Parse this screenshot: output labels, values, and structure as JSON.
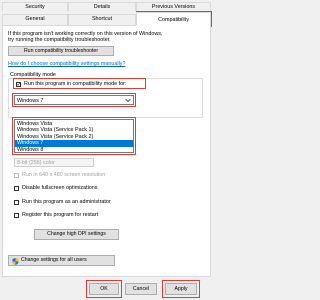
{
  "tabs_row1": [
    "Security",
    "Details",
    "Previous Versions"
  ],
  "tabs_row2": [
    "General",
    "Shortcut",
    "Compatibility"
  ],
  "intro_text_line1": "If this program isn't working correctly on this version of Windows,",
  "intro_text_line2": "try running the compatibility troubleshooter.",
  "run_troubleshooter_button": "Run compatibility troubleshooter",
  "choose_settings_link": "How do I choose compatibility settings manually?",
  "compat_mode": {
    "group_label": "Compatibility mode",
    "checkbox_label": "Run this program in compatibility mode for:",
    "checked": true,
    "selected": "Windows 7",
    "options": [
      "Windows Vista",
      "Windows Vista (Service Pack 1)",
      "Windows Vista (Service Pack 2)",
      "Windows 7",
      "Windows 8"
    ]
  },
  "settings": {
    "color_value": "8-bit (256) color",
    "run_640": "Run in 640 x 480 screen resolution",
    "disable_fullscreen": "Disable fullscreen optimizations",
    "run_admin": "Run this program as an administrator",
    "register_restart": "Register this program for restart",
    "high_dpi_button": "Change high DPI settings"
  },
  "all_users_button": "Change settings for all users",
  "footer": {
    "ok": "OK",
    "cancel": "Cancel",
    "apply": "Apply"
  },
  "colors": {
    "accent": "#0078d7",
    "highlight": "#e53935",
    "link": "#0066cc"
  }
}
